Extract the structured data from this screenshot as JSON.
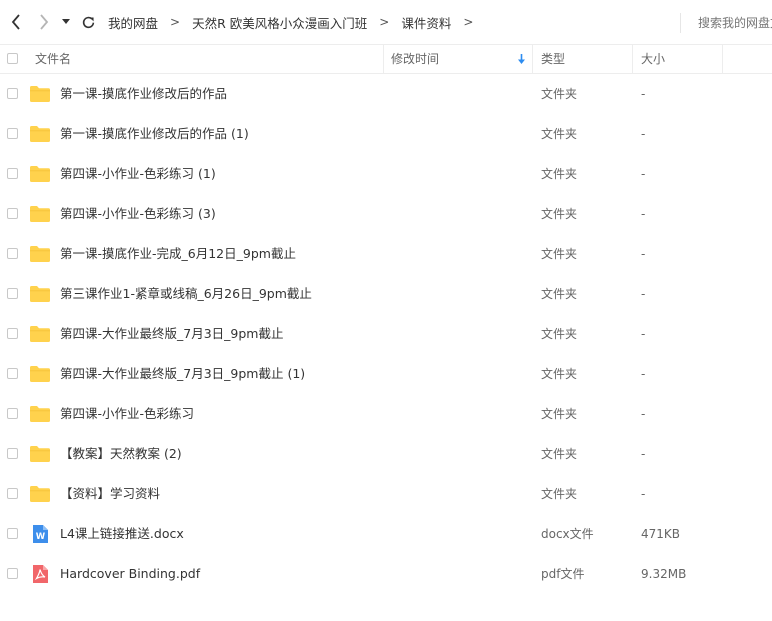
{
  "nav": {
    "back_icon": "chevron-left-icon",
    "forward_icon": "chevron-right-icon",
    "history_icon": "caret-down-icon",
    "refresh_icon": "refresh-icon"
  },
  "breadcrumb": [
    "我的网盘",
    "天然R 欧美风格小众漫画入门班",
    "课件资料"
  ],
  "breadcrumb_separator": ">",
  "search": {
    "placeholder": "搜索我的网盘文件"
  },
  "columns": {
    "name": "文件名",
    "modified": "修改时间",
    "type": "类型",
    "size": "大小"
  },
  "sort_icon": "sort-down-arrow-icon",
  "colors": {
    "folder": "#FFD24D",
    "word": "#3D8EEB",
    "pdf": "#F1666A",
    "sort_arrow": "#2D8CF0"
  },
  "files": [
    {
      "name": "第一课-摸底作业修改后的作品",
      "type": "文件夹",
      "size": "-",
      "icon": "folder-icon"
    },
    {
      "name": "第一课-摸底作业修改后的作品 (1)",
      "type": "文件夹",
      "size": "-",
      "icon": "folder-icon"
    },
    {
      "name": "第四课-小作业-色彩练习 (1)",
      "type": "文件夹",
      "size": "-",
      "icon": "folder-icon"
    },
    {
      "name": "第四课-小作业-色彩练习 (3)",
      "type": "文件夹",
      "size": "-",
      "icon": "folder-icon"
    },
    {
      "name": "第一课-摸底作业-完成_6月12日_9pm截止",
      "type": "文件夹",
      "size": "-",
      "icon": "folder-icon"
    },
    {
      "name": "第三课作业1-紧章或线稿_6月26日_9pm截止",
      "type": "文件夹",
      "size": "-",
      "icon": "folder-icon"
    },
    {
      "name": "第四课-大作业最终版_7月3日_9pm截止",
      "type": "文件夹",
      "size": "-",
      "icon": "folder-icon"
    },
    {
      "name": "第四课-大作业最终版_7月3日_9pm截止 (1)",
      "type": "文件夹",
      "size": "-",
      "icon": "folder-icon"
    },
    {
      "name": "第四课-小作业-色彩练习",
      "type": "文件夹",
      "size": "-",
      "icon": "folder-icon"
    },
    {
      "name": "【教案】天然教案 (2)",
      "type": "文件夹",
      "size": "-",
      "icon": "folder-icon"
    },
    {
      "name": "【资料】学习资料",
      "type": "文件夹",
      "size": "-",
      "icon": "folder-icon"
    },
    {
      "name": "L4课上链接推送.docx",
      "type": "docx文件",
      "size": "471KB",
      "icon": "word-doc-icon"
    },
    {
      "name": "Hardcover Binding.pdf",
      "type": "pdf文件",
      "size": "9.32MB",
      "icon": "pdf-icon"
    }
  ]
}
